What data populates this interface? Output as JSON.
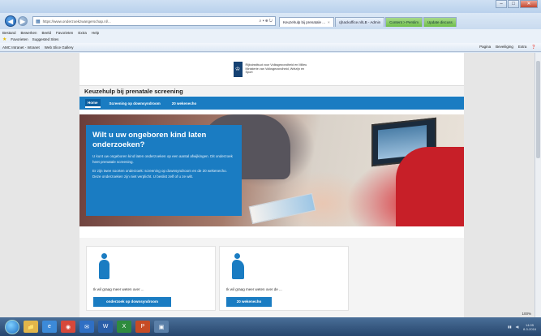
{
  "browser": {
    "url": "https://www.onderzoekzwangerschap.nl/...",
    "address_tools": "⌕ ▾ ⊕ ↻",
    "tabs": [
      {
        "label": "Keuzehulp bij prenatale ...",
        "active": true
      },
      {
        "label": "cjhackoffice.nl/LB - Admin",
        "active": false
      },
      {
        "label": "Content > Perslim",
        "active": false,
        "green": true
      },
      {
        "label": "Update  discuss",
        "active": false,
        "green": true
      }
    ],
    "menu": [
      "Bestand",
      "Bewerken",
      "Beeld",
      "Favorieten",
      "Extra",
      "Help"
    ],
    "favorites": [
      "Favorieten",
      "Suggested Sites"
    ],
    "links_bar": [
      "AMC Intranet - Intranet",
      "Web Slice Gallery"
    ],
    "commands": [
      "Pagina",
      "Beveiliging",
      "Extra",
      "❓"
    ],
    "zoom": "100%"
  },
  "site": {
    "gov_mark": "♔",
    "gov_text": "Rijksinstituut voor Volksgezondheid en Milieu Ministerie van Volksgezondheid, Welzijn en Sport",
    "title": "Keuzehulp bij prenatale screening",
    "nav": [
      {
        "label": "Home",
        "active": true
      },
      {
        "label": "Screening op downsyndroom",
        "active": false
      },
      {
        "label": "20 wekenecho",
        "active": false
      }
    ]
  },
  "hero": {
    "heading": "Wilt u uw ongeboren kind laten onderzoeken?",
    "para1": "U kunt uw ongeboren kind laten onderzoeken op een aantal afwijkingen. Dit onderzoek heet prenatale screening.",
    "para2": "Er zijn twee soorten onderzoek: screening op downsyndroom en de 20 wekenecho. Deze onderzoeken zijn niet verplicht. U beslist zelf of u ze wilt."
  },
  "cards": [
    {
      "label": "Ik wil graag meer weten over ...",
      "button": "onderzoek op downsyndroom"
    },
    {
      "label": "Ik wil graag meer weten over de ...",
      "button": "20 wekenecho"
    }
  ],
  "taskbar": {
    "apps": [
      {
        "icon": "📁",
        "color": "#e2b64a"
      },
      {
        "icon": "e",
        "color": "#3c8ad8"
      },
      {
        "icon": "◉",
        "color": "#d6483a"
      },
      {
        "icon": "✉",
        "color": "#2f6fc4"
      },
      {
        "icon": "W",
        "color": "#2a5ea8"
      },
      {
        "icon": "X",
        "color": "#2e8b3e"
      },
      {
        "icon": "P",
        "color": "#c74b24"
      },
      {
        "icon": "▣",
        "color": "#5a7fa8"
      }
    ],
    "time": "14:05",
    "date": "8-3-2016"
  },
  "colors": {
    "accent": "#1a7cc2",
    "gov_blue": "#154273"
  }
}
